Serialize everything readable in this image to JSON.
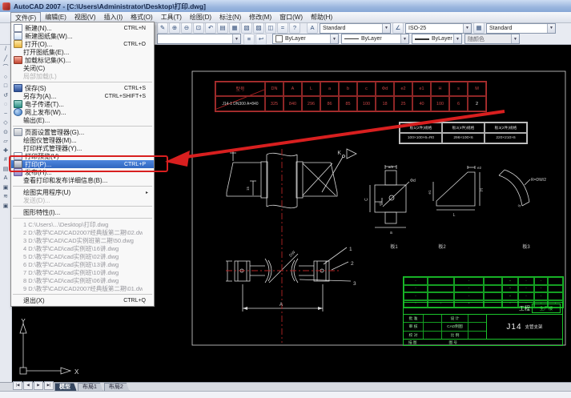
{
  "title_bar": {
    "title": "AutoCAD 2007 - [C:\\Users\\Administrator\\Desktop\\打印.dwg]"
  },
  "menu_bar": {
    "items": [
      {
        "label": "文件(F)",
        "active": true,
        "name": "menu-file"
      },
      {
        "label": "编辑(E)",
        "name": "menu-edit"
      },
      {
        "label": "视图(V)",
        "name": "menu-view"
      },
      {
        "label": "插入(I)",
        "name": "menu-insert"
      },
      {
        "label": "格式(O)",
        "name": "menu-format"
      },
      {
        "label": "工具(T)",
        "name": "menu-tools"
      },
      {
        "label": "绘图(D)",
        "name": "menu-draw"
      },
      {
        "label": "标注(N)",
        "name": "menu-dimension"
      },
      {
        "label": "修改(M)",
        "name": "menu-modify"
      },
      {
        "label": "窗口(W)",
        "name": "menu-window"
      },
      {
        "label": "帮助(H)",
        "name": "menu-help"
      }
    ]
  },
  "toolbar": {
    "row1_icons": [
      {
        "name": "markup-icon",
        "glyph": "✎"
      },
      {
        "name": "zoom-realtime-icon",
        "glyph": "⊕"
      },
      {
        "name": "zoom-out-icon",
        "glyph": "⊖"
      },
      {
        "name": "zoom-window-icon",
        "glyph": "⊡"
      },
      {
        "name": "zoom-previous-icon",
        "glyph": "↶"
      },
      {
        "name": "properties-icon",
        "glyph": "▤"
      },
      {
        "name": "designcenter-icon",
        "glyph": "▦"
      },
      {
        "name": "tool-palettes-icon",
        "glyph": "▧"
      },
      {
        "name": "sheetset-manager-icon",
        "glyph": "▨"
      },
      {
        "name": "markup-set-manager-icon",
        "glyph": "◫"
      },
      {
        "name": "quickcalc-icon",
        "glyph": "="
      },
      {
        "name": "help-icon",
        "glyph": "?"
      }
    ],
    "row2_icons": [
      {
        "name": "make-layer-current-icon",
        "glyph": "≡"
      },
      {
        "name": "layer-previous-icon",
        "glyph": "↩"
      }
    ],
    "text_style": "Standard",
    "dim_style": "ISO-25",
    "table_style": "Standard",
    "layer_value": "",
    "color_value": "ByLayer",
    "linetype_value": "ByLayer",
    "lineweight_value": "ByLayer",
    "plot_style_value": "随颜色"
  },
  "left_toolbar": {
    "icons": [
      "/",
      "╱",
      "⌒",
      "○",
      "□",
      "↺",
      "◌",
      "~",
      "◇",
      "⊙",
      "▱",
      "✚",
      "#",
      "▤",
      "A",
      "▣",
      "≋",
      "▣"
    ]
  },
  "file_menu": {
    "items": [
      {
        "icon": "new-file-icon",
        "label": "新建(N)...",
        "shortcut": "CTRL+N",
        "name": "menu-item-new"
      },
      {
        "icon": "new-sheetset-icon",
        "label": "新建图纸集(W)...",
        "name": "menu-item-new-sheetset"
      },
      {
        "icon": "open-file-icon",
        "label": "打开(O)...",
        "shortcut": "CTRL+O",
        "name": "menu-item-open"
      },
      {
        "label": "打开图纸集(E)...",
        "name": "menu-item-open-sheetset"
      },
      {
        "icon": "load-markup-icon",
        "label": "加载标记集(K)...",
        "name": "menu-item-load-markup"
      },
      {
        "label": "关闭(C)",
        "name": "menu-item-close"
      },
      {
        "label": "局部加载(L)",
        "disabled": true,
        "name": "menu-item-partial-load"
      },
      {
        "separator": true
      },
      {
        "icon": "save-icon",
        "label": "保存(S)",
        "shortcut": "CTRL+S",
        "name": "menu-item-save"
      },
      {
        "label": "另存为(A)...",
        "shortcut": "CTRL+SHIFT+S",
        "name": "menu-item-save-as"
      },
      {
        "icon": "etransmit-icon",
        "label": "电子传递(T)...",
        "name": "menu-item-etransmit"
      },
      {
        "icon": "web-publish-icon",
        "label": "网上发布(W)...",
        "name": "menu-item-publish-web"
      },
      {
        "label": "输出(E)...",
        "name": "menu-item-export"
      },
      {
        "separator": true
      },
      {
        "icon": "page-setup-icon",
        "label": "页面设置管理器(G)...",
        "name": "menu-item-page-setup-manager"
      },
      {
        "label": "绘图仪管理器(M)...",
        "name": "menu-item-plotter-manager"
      },
      {
        "label": "打印样式管理器(Y)...",
        "name": "menu-item-plot-style-manager"
      },
      {
        "icon": "plot-preview-icon",
        "label": "打印预览(V)",
        "name": "menu-item-plot-preview"
      },
      {
        "icon": "print-icon",
        "label": "打印(P)...",
        "shortcut": "CTRL+P",
        "highlighted": true,
        "name": "menu-item-plot"
      },
      {
        "icon": "publish-icon",
        "label": "发布(H)...",
        "name": "menu-item-publish"
      },
      {
        "label": "查看打印和发布详细信息(B)...",
        "name": "menu-item-plot-details"
      },
      {
        "separator": true
      },
      {
        "label": "绘图实用程序(U)",
        "submenu": true,
        "name": "menu-item-drawing-utilities"
      },
      {
        "label": "发送(D)...",
        "disabled": true,
        "name": "menu-item-send"
      },
      {
        "separator": true
      },
      {
        "label": "图形特性(I)...",
        "name": "menu-item-drawing-properties"
      },
      {
        "separator": true
      },
      {
        "label": "1 C:\\Users\\...\\Desktop\\打印.dwg",
        "recent": true,
        "name": "recent-file-1"
      },
      {
        "label": "2 D:\\教学\\CAD\\CAD2007经典版第二期\\02.dwg",
        "recent": true,
        "name": "recent-file-2"
      },
      {
        "label": "3 D:\\教学\\CAD\\CAD实例班第二期\\50.dwg",
        "recent": true,
        "name": "recent-file-3"
      },
      {
        "label": "4 D:\\教学\\CAD\\cad实例班\\16讲.dwg",
        "recent": true,
        "name": "recent-file-4"
      },
      {
        "label": "5 D:\\教学\\CAD\\cad实例班\\02讲.dwg",
        "recent": true,
        "name": "recent-file-5"
      },
      {
        "label": "6 D:\\教学\\CAD\\cad实例班\\13讲.dwg",
        "recent": true,
        "name": "recent-file-6"
      },
      {
        "label": "7 D:\\教学\\CAD\\cad实例班\\10讲.dwg",
        "recent": true,
        "name": "recent-file-7"
      },
      {
        "label": "8 D:\\教学\\CAD\\cad实例班\\06讲.dwg",
        "recent": true,
        "name": "recent-file-8"
      },
      {
        "label": "9 D:\\教学\\CAD\\CAD2007经典版第二期\\01.dwg",
        "recent": true,
        "name": "recent-file-9"
      },
      {
        "separator": true
      },
      {
        "label": "退出(X)",
        "shortcut": "CTRL+Q",
        "name": "menu-item-exit"
      }
    ]
  },
  "drawing": {
    "param_table": {
      "headers": [
        "型号",
        "DN",
        "A",
        "L",
        "a",
        "b",
        "c",
        "Φd",
        "e2",
        "e1",
        "H",
        "s",
        "M"
      ],
      "values": [
        "J14-1 DN300 A=840",
        "325",
        "840",
        "296",
        "86",
        "85",
        "100",
        "18",
        "25",
        "40",
        "100",
        "6",
        "2"
      ]
    },
    "plate_table": {
      "headers": [
        "板1(2件)规格",
        "板2(4件)规格",
        "板3(2件)规格"
      ],
      "values": [
        "100×100×6=R0",
        "296×100×6",
        "220×210×6"
      ]
    },
    "bom_cells": [
      "·",
      "",
      "·",
      "",
      "-",
      "·",
      "·",
      "",
      "·",
      "",
      "·",
      "",
      "-",
      "·",
      "·",
      "",
      "·",
      "",
      "·",
      "",
      "-",
      "·",
      "·",
      "",
      "·",
      "·",
      "-",
      "",
      "·",
      "·",
      "·",
      "·"
    ],
    "labels": {
      "k": "K",
      "dim15": "15",
      "a": "A",
      "dw": "DW",
      "n1": "1",
      "n2": "2",
      "n3": "3",
      "phi_d": "Φd",
      "a_half": "a/2",
      "c": "C",
      "c_half": "c/2",
      "a_small": "a",
      "e2": "e2",
      "e1": "e1",
      "h": "H",
      "l": "L",
      "r": "R=DW/2",
      "s": "S",
      "p1": "板1",
      "p2": "板2",
      "p3": "板3"
    },
    "title_block": {
      "project_label": "工程",
      "project_value": "生产楼",
      "code": "J14",
      "name": "支管支架",
      "rows": [
        {
          "l1": "批 准",
          "v1": "",
          "l2": "设 计",
          "v2": ""
        },
        {
          "l1": "审 核",
          "v1": "",
          "l2": "CAD制图",
          "v2": ""
        },
        {
          "l1": "校 对",
          "v1": "",
          "l2": "比 例",
          "v2": ""
        }
      ],
      "bottom_left": "描 图",
      "bottom_right": "图 号"
    }
  },
  "tabs": {
    "nav": [
      "|◀",
      "◀",
      "▶",
      "▶|"
    ],
    "items": [
      {
        "label": "模型",
        "active": true,
        "name": "tab-model"
      },
      {
        "label": "布局1",
        "name": "tab-layout1"
      },
      {
        "label": "布局2",
        "name": "tab-layout2"
      }
    ]
  },
  "ucs": {
    "x": "X",
    "y": "Y"
  }
}
